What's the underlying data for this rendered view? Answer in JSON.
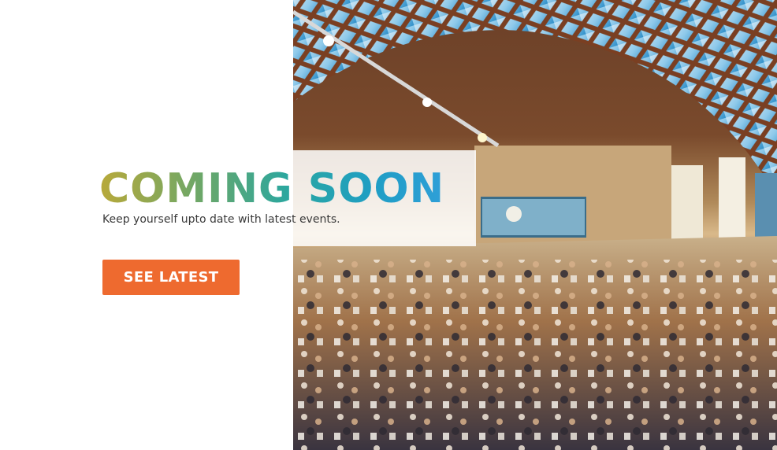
{
  "hero": {
    "headline": "COMING SOON",
    "subline": "Keep yourself upto date with latest events.",
    "cta_label": "SEE LATEST",
    "cta_color": "#ee6a2f",
    "headline_gradient": [
      "#b8a93a",
      "#6aa76a",
      "#2aa7a0",
      "#1f9ec5",
      "#2f9fd8"
    ]
  },
  "image": {
    "subject": "banquet-hall-event-photo"
  }
}
